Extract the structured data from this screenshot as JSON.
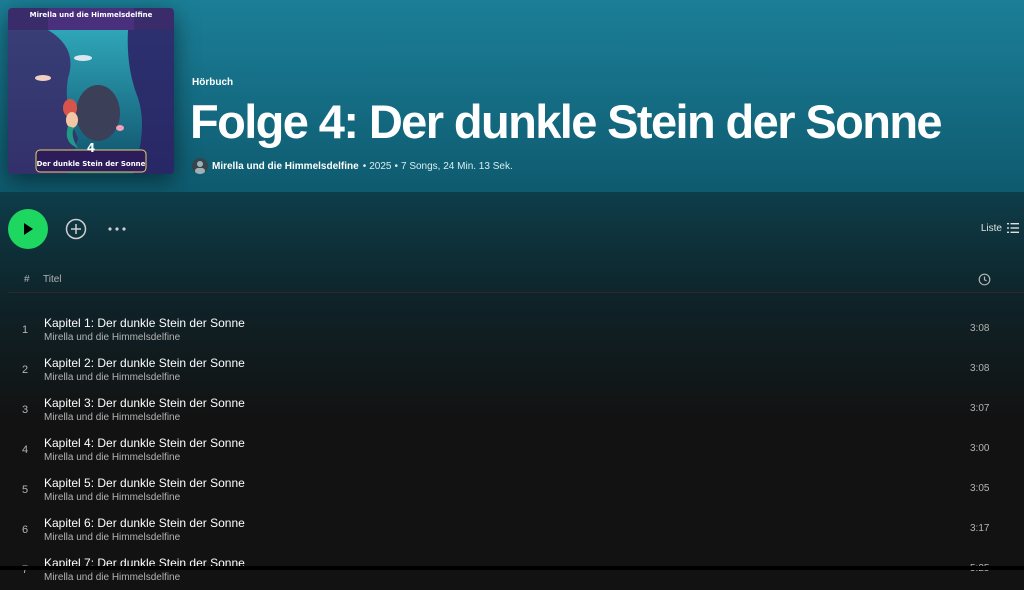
{
  "album": {
    "type": "Hörbuch",
    "title": "Folge 4: Der dunkle Stein der Sonne",
    "artist": "Mirella und die Himmelsdelfine",
    "year": "2025",
    "summary": "7 Songs, 24 Min. 13 Sek.",
    "cover": {
      "series": "Mirella und die Himmelsdelfine",
      "number": "4",
      "subtitle": "Der dunkle Stein der Sonne"
    }
  },
  "actions": {
    "view_label": "Liste",
    "play_icon": "play-icon",
    "add_icon": "plus-circle-icon",
    "more_icon": "more-icon",
    "view_icon": "list-icon"
  },
  "columns": {
    "number": "#",
    "title": "Titel",
    "duration_icon": "clock-icon"
  },
  "colors": {
    "accent": "#1ed760",
    "header": "#1b7f97",
    "background": "#121212"
  },
  "tracks": [
    {
      "index": "1",
      "title": "Kapitel 1: Der dunkle Stein der Sonne",
      "artist": "Mirella und die Himmelsdelfine",
      "duration": "3:08"
    },
    {
      "index": "2",
      "title": "Kapitel 2: Der dunkle Stein der Sonne",
      "artist": "Mirella und die Himmelsdelfine",
      "duration": "3:08"
    },
    {
      "index": "3",
      "title": "Kapitel 3: Der dunkle Stein der Sonne",
      "artist": "Mirella und die Himmelsdelfine",
      "duration": "3:07"
    },
    {
      "index": "4",
      "title": "Kapitel 4: Der dunkle Stein der Sonne",
      "artist": "Mirella und die Himmelsdelfine",
      "duration": "3:00"
    },
    {
      "index": "5",
      "title": "Kapitel 5: Der dunkle Stein der Sonne",
      "artist": "Mirella und die Himmelsdelfine",
      "duration": "3:05"
    },
    {
      "index": "6",
      "title": "Kapitel 6: Der dunkle Stein der Sonne",
      "artist": "Mirella und die Himmelsdelfine",
      "duration": "3:17"
    },
    {
      "index": "7",
      "title": "Kapitel 7: Der dunkle Stein der Sonne",
      "artist": "Mirella und die Himmelsdelfine",
      "duration": "5:25"
    }
  ]
}
